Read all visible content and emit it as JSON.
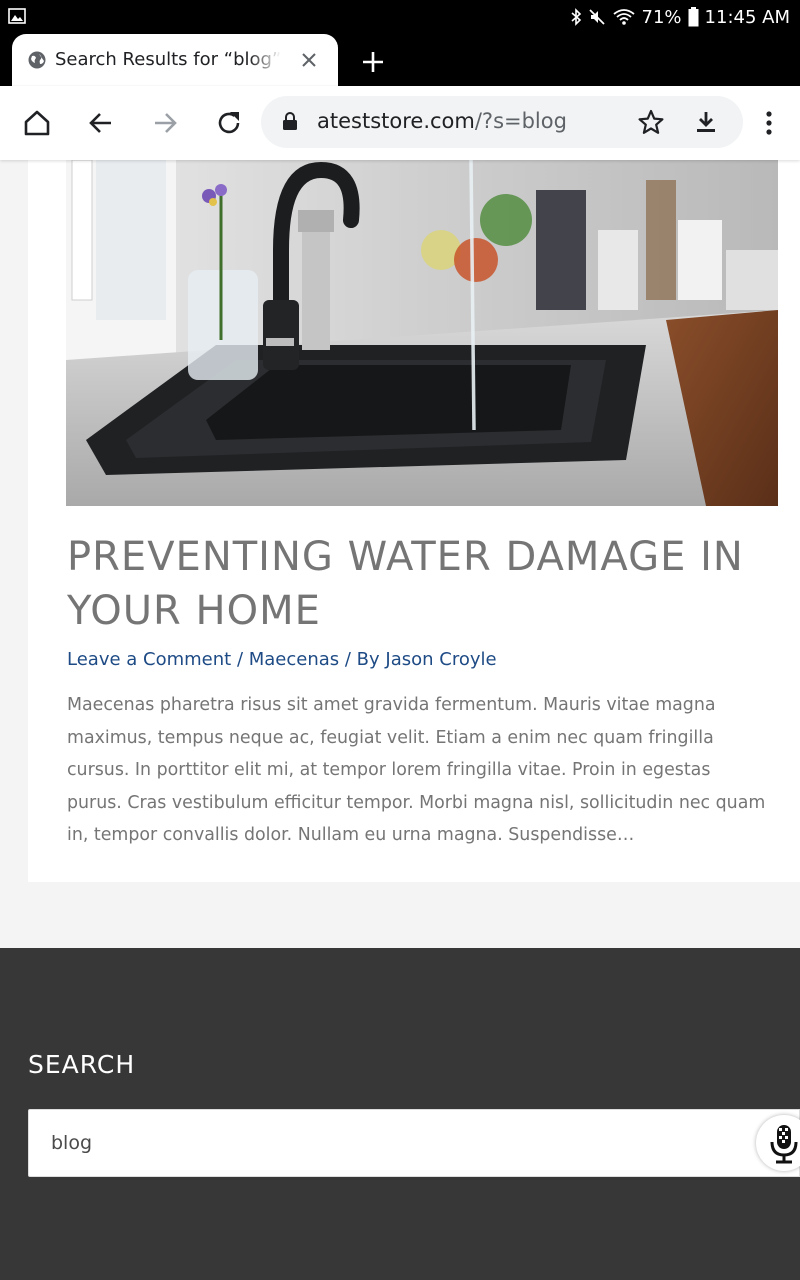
{
  "status_bar": {
    "battery": "71%",
    "time": "11:45 AM",
    "icons": [
      "gallery-icon",
      "bluetooth-icon",
      "mute-icon",
      "wifi-icon",
      "battery-icon"
    ]
  },
  "tab": {
    "title": "Search Results for “blog” – A Test Store",
    "icon": "globe-icon"
  },
  "toolbar": {
    "url_host": "ateststore.com",
    "url_path": "/?s=blog",
    "icons": [
      "home-icon",
      "back-icon",
      "forward-icon",
      "reload-icon",
      "lock-icon",
      "star-icon",
      "download-icon",
      "menu-icon"
    ]
  },
  "post": {
    "title": "PREVENTING WATER DAMAGE IN YOUR HOME",
    "comments_link": "Leave a Comment",
    "sep1": " / ",
    "category": "Maecenas",
    "sep2": " / By ",
    "author": "Jason Croyle",
    "excerpt": "Maecenas pharetra risus sit amet gravida fermentum. Mauris vitae magna maximus, tempus neque ac, feugiat velit. Etiam a enim nec quam fringilla cursus. In porttitor elit mi, at tempor lorem fringilla vitae. Proin in egestas purus. Cras vestibulum efficitur tempor. Morbi magna nisl, sollicitudin nec quam in, tempor convallis dolor. Nullam eu urna magna. Suspendisse…"
  },
  "footer": {
    "search_title": "SEARCH",
    "search_value": "blog"
  }
}
